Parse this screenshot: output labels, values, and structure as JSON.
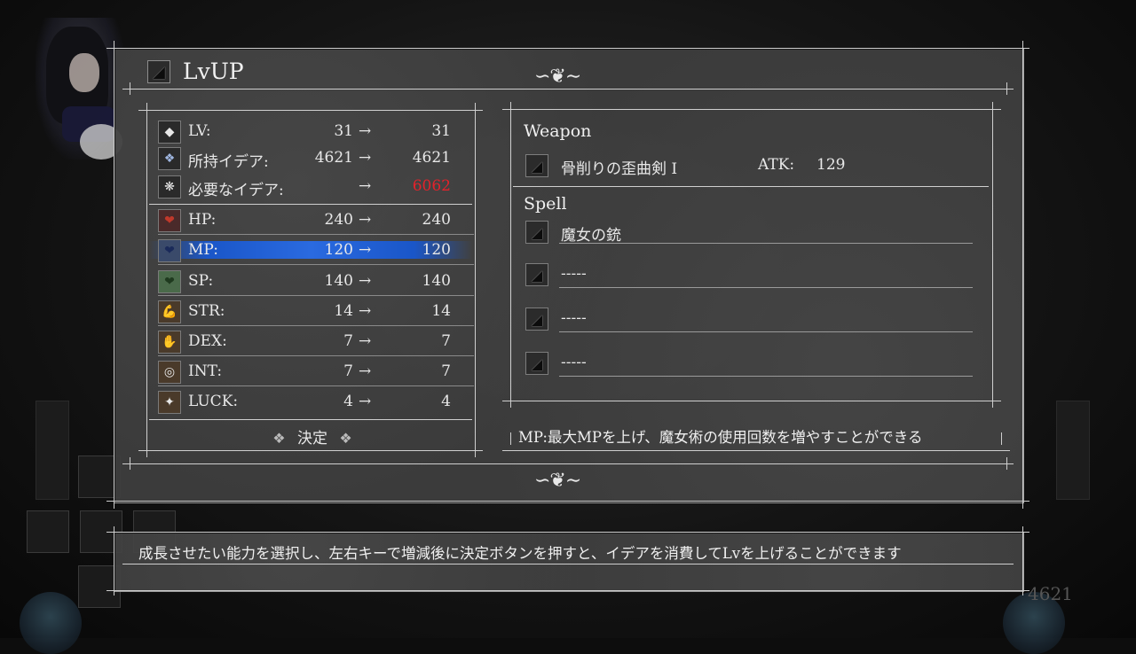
{
  "window": {
    "title": "LvUP"
  },
  "stats_header": [
    {
      "icon": "lv-diamond-icon",
      "label": "LV:",
      "from": "31",
      "arrow": "→",
      "to": "31",
      "to_color": "#e8e8e8"
    },
    {
      "icon": "idea-snowflake-icon",
      "label": "所持イデア:",
      "from": "4621",
      "arrow": "→",
      "to": "4621",
      "to_color": "#e8e8e8"
    },
    {
      "icon": "required-idea-icon",
      "label": "必要なイデア:",
      "from": "",
      "arrow": "→",
      "to": "6062",
      "to_color": "#e3222b"
    }
  ],
  "stats": [
    {
      "icon": "heart-hp-icon",
      "label": "HP:",
      "from": "240",
      "arrow": "→",
      "to": "240",
      "selected": false
    },
    {
      "icon": "heart-mp-icon",
      "label": "MP:",
      "from": "120",
      "arrow": "→",
      "to": "120",
      "selected": true
    },
    {
      "icon": "heart-sp-icon",
      "label": "SP:",
      "from": "140",
      "arrow": "→",
      "to": "140",
      "selected": false
    },
    {
      "icon": "arm-str-icon",
      "label": "STR:",
      "from": "14",
      "arrow": "→",
      "to": "14",
      "selected": false
    },
    {
      "icon": "hand-dex-icon",
      "label": "DEX:",
      "from": "7",
      "arrow": "→",
      "to": "7",
      "selected": false
    },
    {
      "icon": "brain-int-icon",
      "label": "INT:",
      "from": "7",
      "arrow": "→",
      "to": "7",
      "selected": false
    },
    {
      "icon": "star-luck-icon",
      "label": "LUCK:",
      "from": "4",
      "arrow": "→",
      "to": "4",
      "selected": false
    }
  ],
  "confirm_label": "決定",
  "weapon": {
    "heading": "Weapon",
    "name": "骨削りの歪曲剣 I",
    "atk_label": "ATK:",
    "atk_value": "129"
  },
  "spell": {
    "heading": "Spell",
    "slots": [
      "魔女の銃",
      "-----",
      "-----",
      "-----"
    ]
  },
  "description": "MP:最大MPを上げ、魔女術の使用回数を増やすことができる",
  "help": "成長させたい能力を選択し、左右キーで増減後に決定ボタンを押すと、イデアを消費してLvを上げることができます",
  "background_counter": "4621",
  "colors": {
    "selection": "#2a6ae0",
    "required_idea": "#e3222b"
  }
}
